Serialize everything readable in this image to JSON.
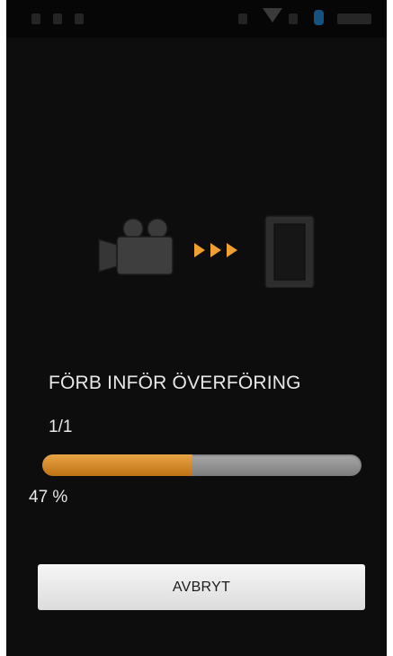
{
  "status_bar": {
    "icons": [
      "notification-icon",
      "notification-icon",
      "notification-icon",
      "notification-icon",
      "wifi-signal-icon",
      "bluetooth-icon",
      "clock"
    ]
  },
  "graphic": {
    "source": "video-camera-icon",
    "arrows": "transfer-arrows-icon",
    "target": "smartphone-icon",
    "arrow_color": "#f0a030"
  },
  "transfer": {
    "status": "FÖRB INFÖR ÖVERFÖRING",
    "count": "1/1",
    "progress": 0.47,
    "percent_label": "47 %",
    "progress_color": "#e09630",
    "track_color": "#8a8a8a"
  },
  "actions": {
    "cancel_label": "AVBRYT"
  }
}
